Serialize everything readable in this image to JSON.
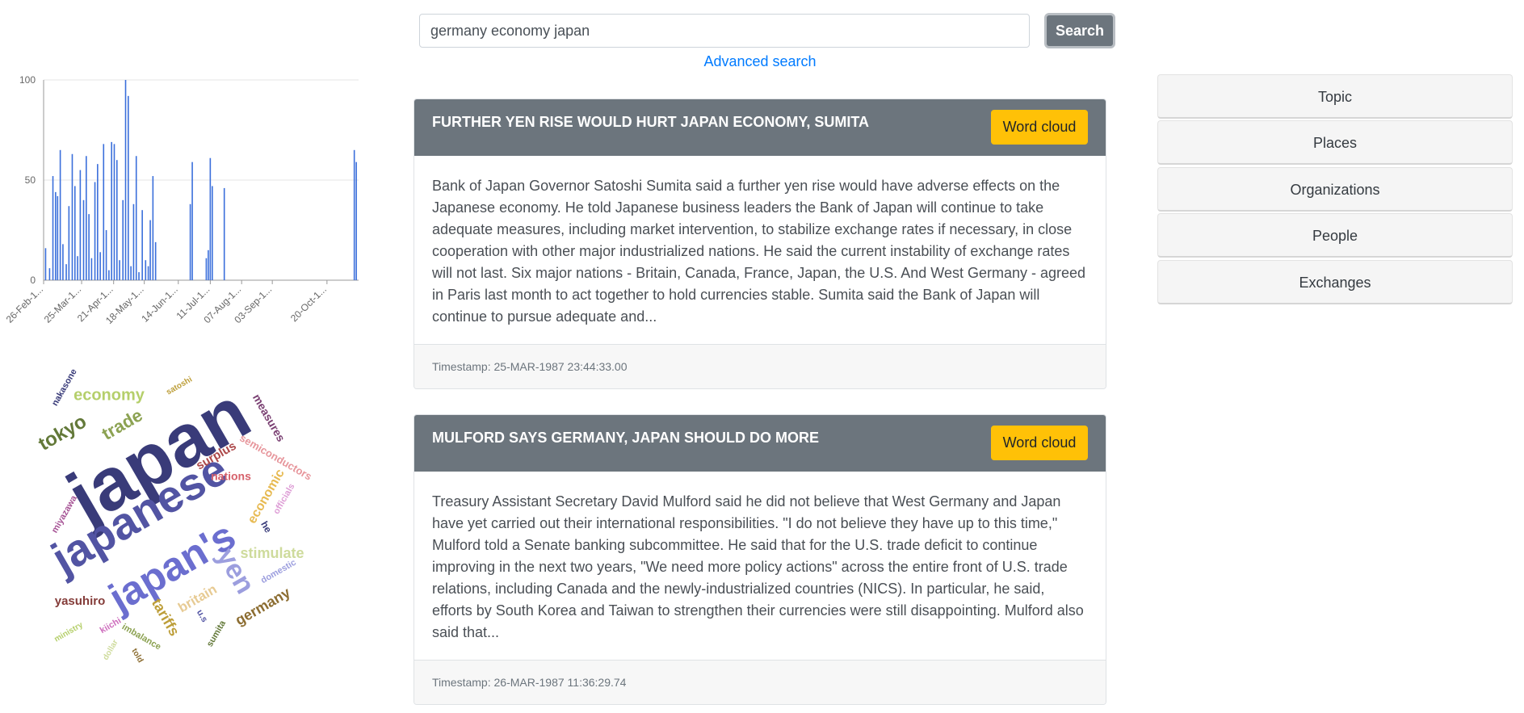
{
  "search": {
    "query": "germany economy japan",
    "button_label": "Search",
    "advanced_label": "Advanced search"
  },
  "chart_data": {
    "type": "bar",
    "ylim": [
      0,
      100
    ],
    "y_ticks": [
      "0",
      "50",
      "100"
    ],
    "x_tick_labels": [
      "26-Feb-1...",
      "25-Mar-1...",
      "21-Apr-1...",
      "18-May-1...",
      "14-Jun-1...",
      "11-Jul-1...",
      "07-Aug-1...",
      "03-Sep-1...",
      "20-Oct-1..."
    ],
    "bar_color": "#3b6fdb",
    "bars": [
      {
        "x": 0.2,
        "y": 16
      },
      {
        "x": 0.8,
        "y": 6
      },
      {
        "x": 1.3,
        "y": 52
      },
      {
        "x": 1.7,
        "y": 44
      },
      {
        "x": 2.0,
        "y": 42
      },
      {
        "x": 2.4,
        "y": 65
      },
      {
        "x": 2.8,
        "y": 18
      },
      {
        "x": 3.3,
        "y": 8
      },
      {
        "x": 3.7,
        "y": 37
      },
      {
        "x": 4.2,
        "y": 63
      },
      {
        "x": 4.6,
        "y": 47
      },
      {
        "x": 5.0,
        "y": 12
      },
      {
        "x": 5.4,
        "y": 55
      },
      {
        "x": 5.9,
        "y": 40
      },
      {
        "x": 6.3,
        "y": 62
      },
      {
        "x": 6.7,
        "y": 33
      },
      {
        "x": 7.1,
        "y": 11
      },
      {
        "x": 7.6,
        "y": 49
      },
      {
        "x": 8.0,
        "y": 58
      },
      {
        "x": 8.4,
        "y": 14
      },
      {
        "x": 8.9,
        "y": 68
      },
      {
        "x": 9.3,
        "y": 25
      },
      {
        "x": 9.7,
        "y": 5
      },
      {
        "x": 10.1,
        "y": 69
      },
      {
        "x": 10.5,
        "y": 68
      },
      {
        "x": 10.9,
        "y": 60
      },
      {
        "x": 11.3,
        "y": 10
      },
      {
        "x": 11.8,
        "y": 40
      },
      {
        "x": 12.2,
        "y": 100
      },
      {
        "x": 12.6,
        "y": 92
      },
      {
        "x": 13.0,
        "y": 7
      },
      {
        "x": 13.4,
        "y": 38
      },
      {
        "x": 13.8,
        "y": 62
      },
      {
        "x": 14.2,
        "y": 4
      },
      {
        "x": 14.7,
        "y": 35
      },
      {
        "x": 15.2,
        "y": 10
      },
      {
        "x": 15.6,
        "y": 7
      },
      {
        "x": 15.9,
        "y": 30
      },
      {
        "x": 16.3,
        "y": 52
      },
      {
        "x": 16.7,
        "y": 19
      },
      {
        "x": 21.9,
        "y": 38
      },
      {
        "x": 22.2,
        "y": 59
      },
      {
        "x": 24.3,
        "y": 11
      },
      {
        "x": 24.6,
        "y": 15
      },
      {
        "x": 24.9,
        "y": 61
      },
      {
        "x": 25.2,
        "y": 47
      },
      {
        "x": 27.0,
        "y": 46
      },
      {
        "x": 46.5,
        "y": 65
      },
      {
        "x": 46.8,
        "y": 59
      }
    ],
    "x_max": 47
  },
  "wordcloud": {
    "words": [
      {
        "text": "japan",
        "color": "#393b79"
      },
      {
        "text": "japanese",
        "color": "#5254a3"
      },
      {
        "text": "japan's",
        "color": "#6b6ecf"
      },
      {
        "text": "yen",
        "color": "#9c9ede"
      },
      {
        "text": "tokyo",
        "color": "#637939"
      },
      {
        "text": "economy",
        "color": "#b5cf6b"
      },
      {
        "text": "trade",
        "color": "#8ca252"
      },
      {
        "text": "nakasone",
        "color": "#393b79"
      },
      {
        "text": "satoshi",
        "color": "#bd9e39"
      },
      {
        "text": "measures",
        "color": "#7b4173"
      },
      {
        "text": "semiconductors",
        "color": "#e7969c"
      },
      {
        "text": "surplus",
        "color": "#ad494a"
      },
      {
        "text": "nations",
        "color": "#d6616b"
      },
      {
        "text": "economic",
        "color": "#e7ba52"
      },
      {
        "text": "officials",
        "color": "#de9ed6"
      },
      {
        "text": "miyazawa",
        "color": "#a55194"
      },
      {
        "text": "he",
        "color": "#393b79"
      },
      {
        "text": "stimulate",
        "color": "#cedb9c"
      },
      {
        "text": "domestic",
        "color": "#9c9ede"
      },
      {
        "text": "yasuhiro",
        "color": "#843c39"
      },
      {
        "text": "britain",
        "color": "#e7cb94"
      },
      {
        "text": "tariffs",
        "color": "#bd9e39"
      },
      {
        "text": "u.s",
        "color": "#5254a3"
      },
      {
        "text": "germany",
        "color": "#8c6d31"
      },
      {
        "text": "ministry",
        "color": "#b5cf6b"
      },
      {
        "text": "kiichi",
        "color": "#ce6dbd"
      },
      {
        "text": "imbalance",
        "color": "#8ca252"
      },
      {
        "text": "sumita",
        "color": "#637939"
      },
      {
        "text": "dollar",
        "color": "#cedb9c"
      },
      {
        "text": "told",
        "color": "#8c6d31"
      }
    ]
  },
  "articles": [
    {
      "title": "FURTHER YEN RISE WOULD HURT JAPAN ECONOMY, SUMITA",
      "button_label": "Word cloud",
      "body": "Bank of Japan Governor Satoshi Sumita said a further yen rise would have adverse effects on the Japanese economy. He told Japanese business leaders the Bank of Japan will continue to take adequate measures, including market intervention, to stabilize exchange rates if necessary, in close cooperation with other major industrialized nations. He said the current instability of exchange rates will not last. Six major nations - Britain, Canada, France, Japan, the U.S. And West Germany - agreed in Paris last month to act together to hold currencies stable. Sumita said the Bank of Japan will continue to pursue adequate and...",
      "timestamp": "Timestamp: 25-MAR-1987 23:44:33.00"
    },
    {
      "title": "MULFORD SAYS GERMANY, JAPAN SHOULD DO MORE",
      "button_label": "Word cloud",
      "body": "Treasury Assistant Secretary David Mulford said he did not believe that West Germany and Japan have yet carried out their international responsibilities. \"I do not believe they have up to this time,\" Mulford told a Senate banking subcommittee. He said that for the U.S. trade deficit to continue improving in the next two years, \"We need more policy actions\" across the entire front of U.S. trade relations, including Canada and the newly-industrialized countries (NICS). In particular, he said, efforts by South Korea and Taiwan to strengthen their currencies were still disappointing. Mulford also said that...",
      "timestamp": "Timestamp: 26-MAR-1987 11:36:29.74"
    }
  ],
  "facets": [
    "Topic",
    "Places",
    "Organizations",
    "People",
    "Exchanges"
  ]
}
